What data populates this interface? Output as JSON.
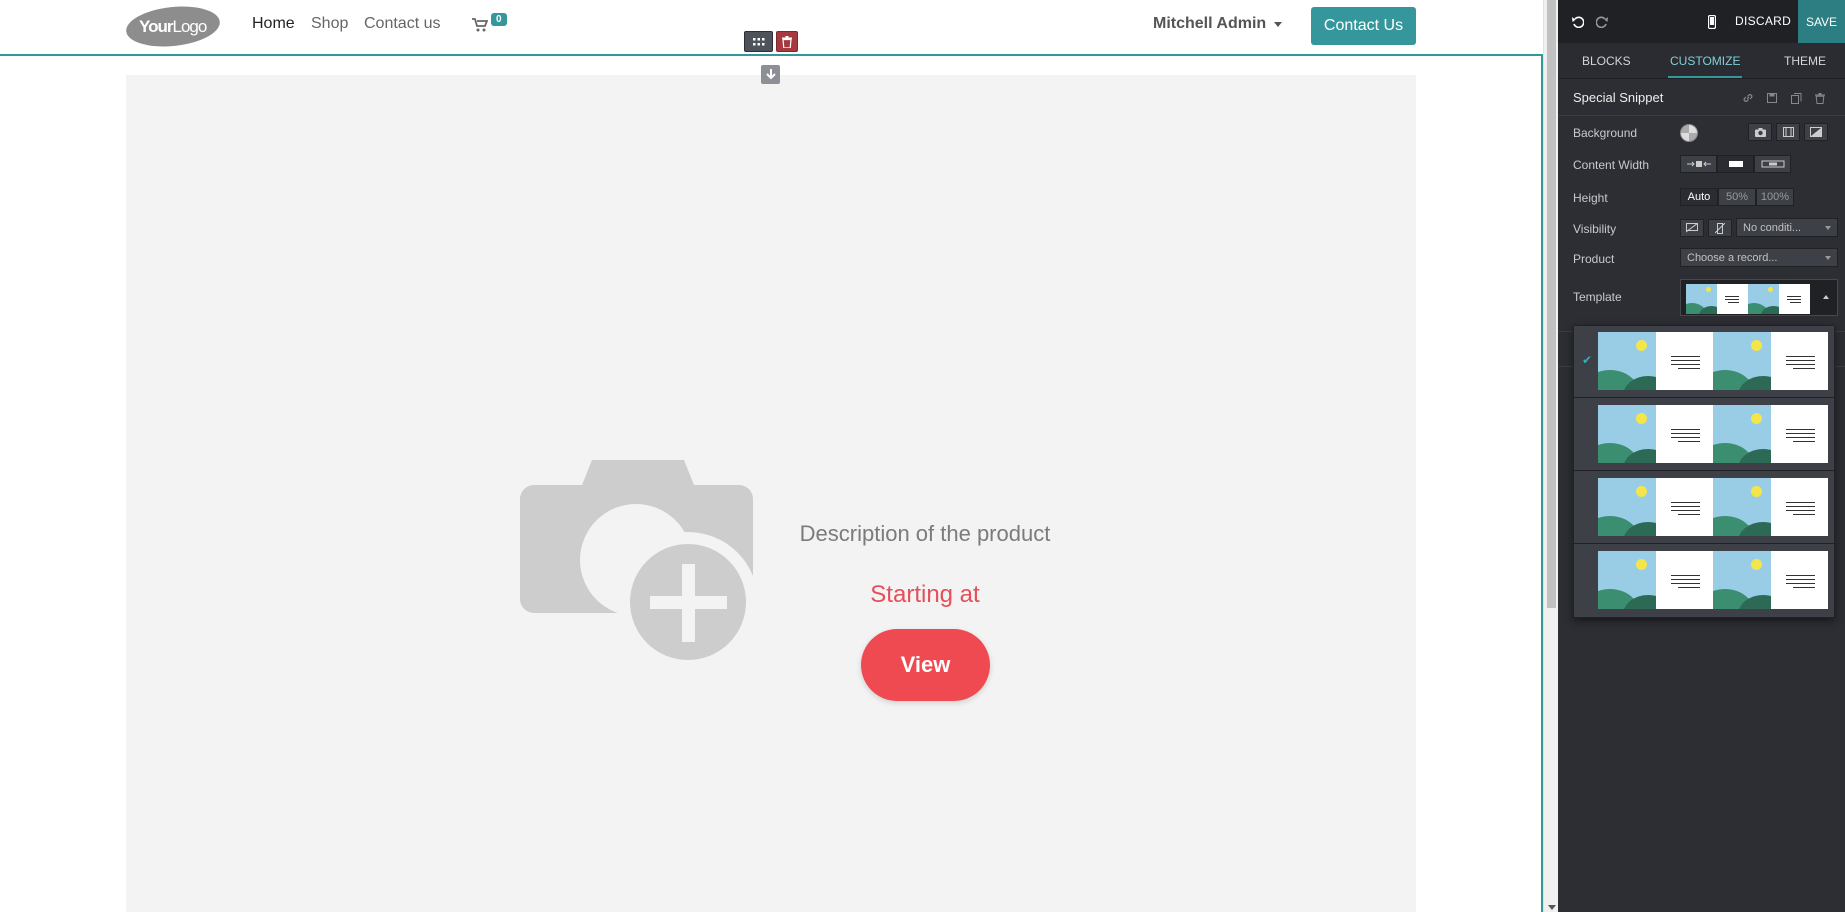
{
  "navbar": {
    "logo_text_a": "Your",
    "logo_text_b": "Logo",
    "links": [
      "Home",
      "Shop",
      "Contact us"
    ],
    "cart_count": "0",
    "user": "Mitchell Admin",
    "cta": "Contact Us"
  },
  "product": {
    "description": "Description of the product",
    "price_label": "Starting at",
    "view_button": "View"
  },
  "editor": {
    "discard": "DISCARD",
    "save": "SAVE",
    "tabs": [
      "BLOCKS",
      "CUSTOMIZE",
      "THEME"
    ],
    "active_tab": "CUSTOMIZE",
    "snippet_title": "Special Snippet",
    "options": {
      "background": "Background",
      "content_width": "Content Width",
      "height": "Height",
      "height_values": [
        "Auto",
        "50%",
        "100%"
      ],
      "visibility": "Visibility",
      "visibility_value": "No conditi...",
      "product": "Product",
      "product_placeholder": "Choose a record...",
      "template": "Template"
    },
    "template_options_count": 4,
    "selected_template_index": 0
  },
  "colors": {
    "accent": "#35979c",
    "editor_bg": "#2c2e34",
    "view_button": "#ef4a52",
    "price": "#e44f5a"
  }
}
